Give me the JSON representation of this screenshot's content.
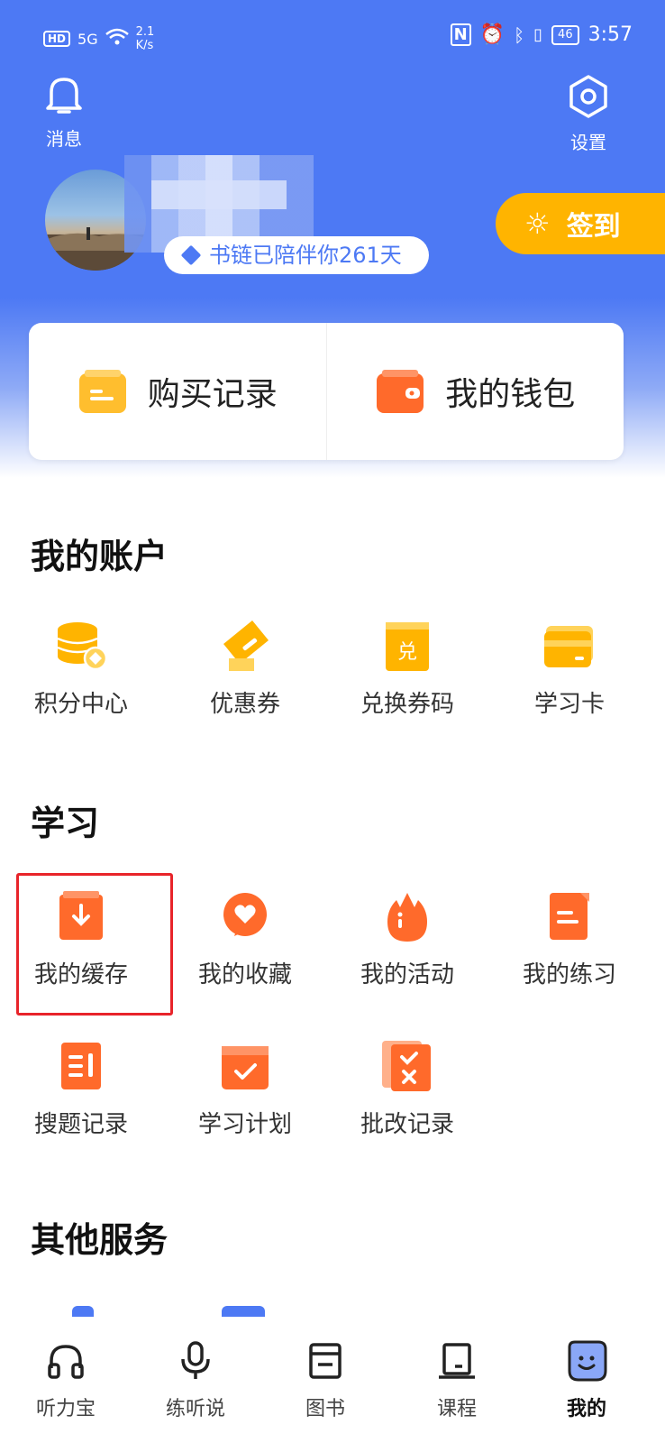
{
  "status_bar": {
    "hd": "HD",
    "signal": "5G",
    "speed": "2.1",
    "speed_unit": "K/s",
    "battery": "46",
    "time": "3:57"
  },
  "header": {
    "messages_label": "消息",
    "settings_label": "设置",
    "companion_days_text": "书链已陪伴你261天",
    "checkin_label": "签到"
  },
  "quick_card": {
    "purchase_records": "购买记录",
    "my_wallet": "我的钱包"
  },
  "sections": {
    "account_title": "我的账户",
    "account_items": [
      "积分中心",
      "优惠券",
      "兑换券码",
      "学习卡"
    ],
    "study_title": "学习",
    "study_items": [
      "我的缓存",
      "我的收藏",
      "我的活动",
      "我的练习",
      "搜题记录",
      "学习计划",
      "批改记录"
    ],
    "other_title": "其他服务"
  },
  "bottom_nav": {
    "items": [
      "听力宝",
      "练听说",
      "图书",
      "课程",
      "我的"
    ],
    "active_index": 4
  },
  "colors": {
    "primary_blue": "#4d79f4",
    "accent_orange": "#ff6a2b",
    "accent_yellow": "#ffb400",
    "highlight_red": "#e8242a"
  }
}
